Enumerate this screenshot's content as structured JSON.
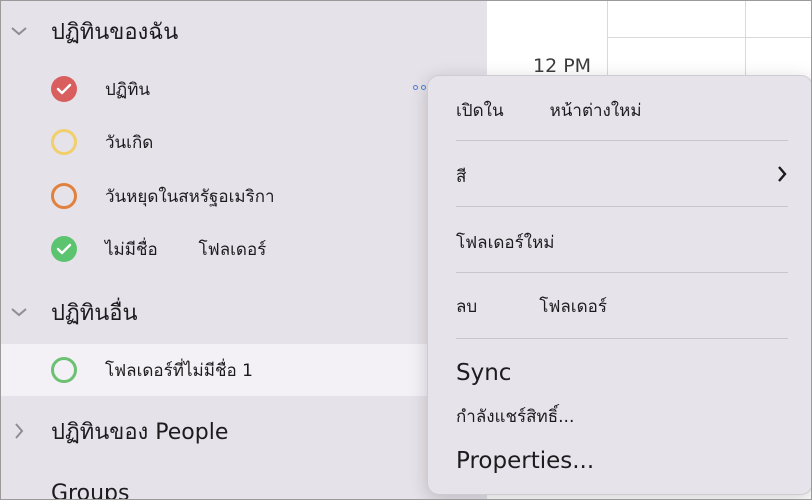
{
  "sidebar": {
    "sections": [
      {
        "title": "ปฏิทินของฉัน",
        "expanded": true,
        "items": [
          {
            "label": "ปฏิทิน",
            "color": "#d95f5f",
            "checked": true
          },
          {
            "label": "วันเกิด",
            "color": "#f1cf6a",
            "checked": false
          },
          {
            "label": "วันหยุดในสหรัฐอเมริกา",
            "color": "#e0823d",
            "checked": false
          },
          {
            "label_a": "ไม่มีชื่อ",
            "label_b": "โฟลเดอร์",
            "color": "#5cc46f",
            "checked": true
          }
        ]
      },
      {
        "title": "ปฏิทินอื่น",
        "expanded": true,
        "items": [
          {
            "label": "โฟลเดอร์ที่ไม่มีชื่อ 1",
            "color": "#6cc071",
            "checked": false,
            "selected": true
          }
        ]
      },
      {
        "title": "ปฏิทินของ People",
        "expanded": false
      },
      {
        "title": "Groups",
        "expanded": false
      }
    ]
  },
  "calendar": {
    "time_label": "12 PM"
  },
  "context_menu": {
    "open_in_a": "เปิดใน",
    "open_in_b": "หน้าต่างใหม่",
    "color": "สี",
    "new_folder": "โฟลเดอร์ใหม่",
    "delete_a": "ลบ",
    "delete_b": "โฟลเดอร์",
    "sync": "Sync",
    "sharing": "กำลังแชร์สิทธิ์...",
    "properties": "Properties..."
  },
  "icons": {
    "chevron": "chevron-down-icon",
    "chevron_collapsed": "chevron-right-icon",
    "submenu": "chevron-right-icon",
    "check": "checkmark-icon"
  }
}
